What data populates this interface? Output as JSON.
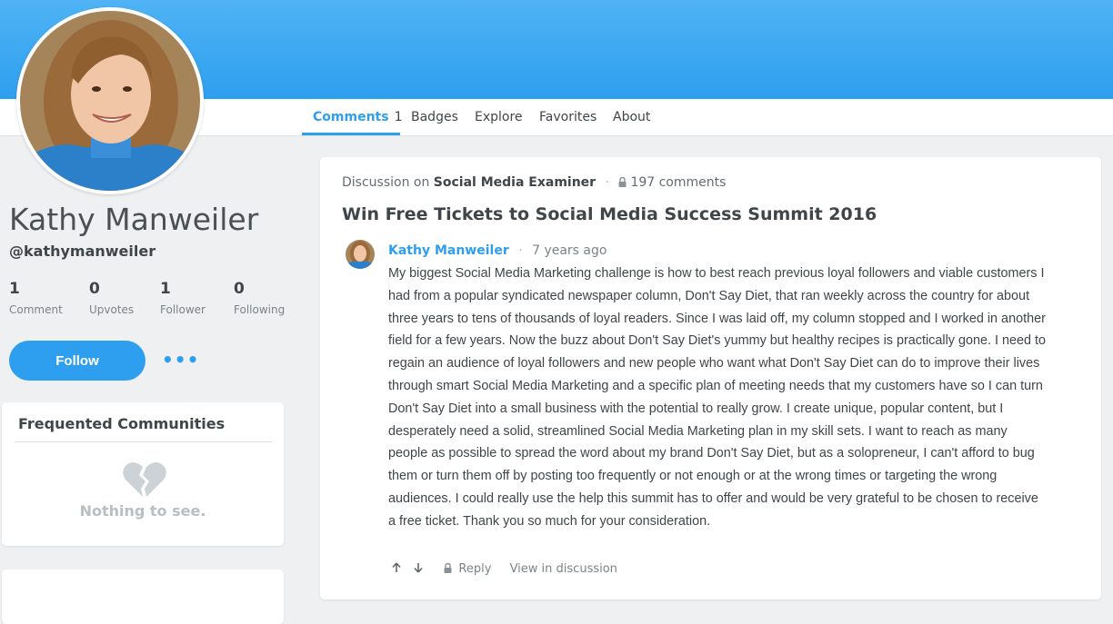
{
  "profile": {
    "name": "Kathy Manweiler",
    "handle": "@kathymanweiler",
    "stats": [
      {
        "value": "1",
        "label": "Comment"
      },
      {
        "value": "0",
        "label": "Upvotes"
      },
      {
        "value": "1",
        "label": "Follower"
      },
      {
        "value": "0",
        "label": "Following"
      }
    ],
    "follow_label": "Follow",
    "more_label": "•••"
  },
  "tabs": [
    {
      "label": "Comments",
      "count": "1",
      "active": true
    },
    {
      "label": "Badges"
    },
    {
      "label": "Explore"
    },
    {
      "label": "Favorites"
    },
    {
      "label": "About"
    }
  ],
  "communities": {
    "title": "Frequented Communities",
    "empty_icon": "broken-heart-icon",
    "empty_text": "Nothing to see."
  },
  "post": {
    "discussion_prefix": "Discussion on",
    "forum": "Social Media Examiner",
    "comment_count": "197 comments",
    "title": "Win Free Tickets to Social Media Success Summit 2016",
    "comment": {
      "author": "Kathy Manweiler",
      "time": "7 years ago",
      "body": "My biggest Social Media Marketing challenge is how to best reach previous loyal followers and viable customers I had from a popular syndicated newspaper column, Don't Say Diet, that ran weekly across the country for about three years to tens of thousands of loyal readers. Since I was laid off, my column stopped and I worked in another field for a few years. Now the buzz about Don't Say Diet's yummy but healthy recipes is practically gone. I need to regain an audience of loyal followers and new people who want what Don't Say Diet can do to improve their lives through smart Social Media Marketing and a specific plan of meeting needs that my customers have so I can turn Don't Say Diet into a small business with the potential to really grow. I create unique, popular content, but I desperately need a solid, streamlined Social Media Marketing plan in my skill sets. I want to reach as many people as possible to spread the word about my brand Don't Say Diet, but as a solopreneur, I can't afford to bug them or turn them off by posting too frequently or not enough or at the wrong times or targeting the wrong audiences. I could really use the help this summit has to offer and would be very grateful to be chosen to receive a free ticket. Thank you so much for your consideration.",
      "upvote_icon": "arrow-up-icon",
      "downvote_icon": "arrow-down-icon",
      "reply_label": "Reply",
      "view_label": "View in discussion"
    }
  },
  "colors": {
    "accent": "#2e9fee",
    "banner": "#4fb3f5"
  }
}
